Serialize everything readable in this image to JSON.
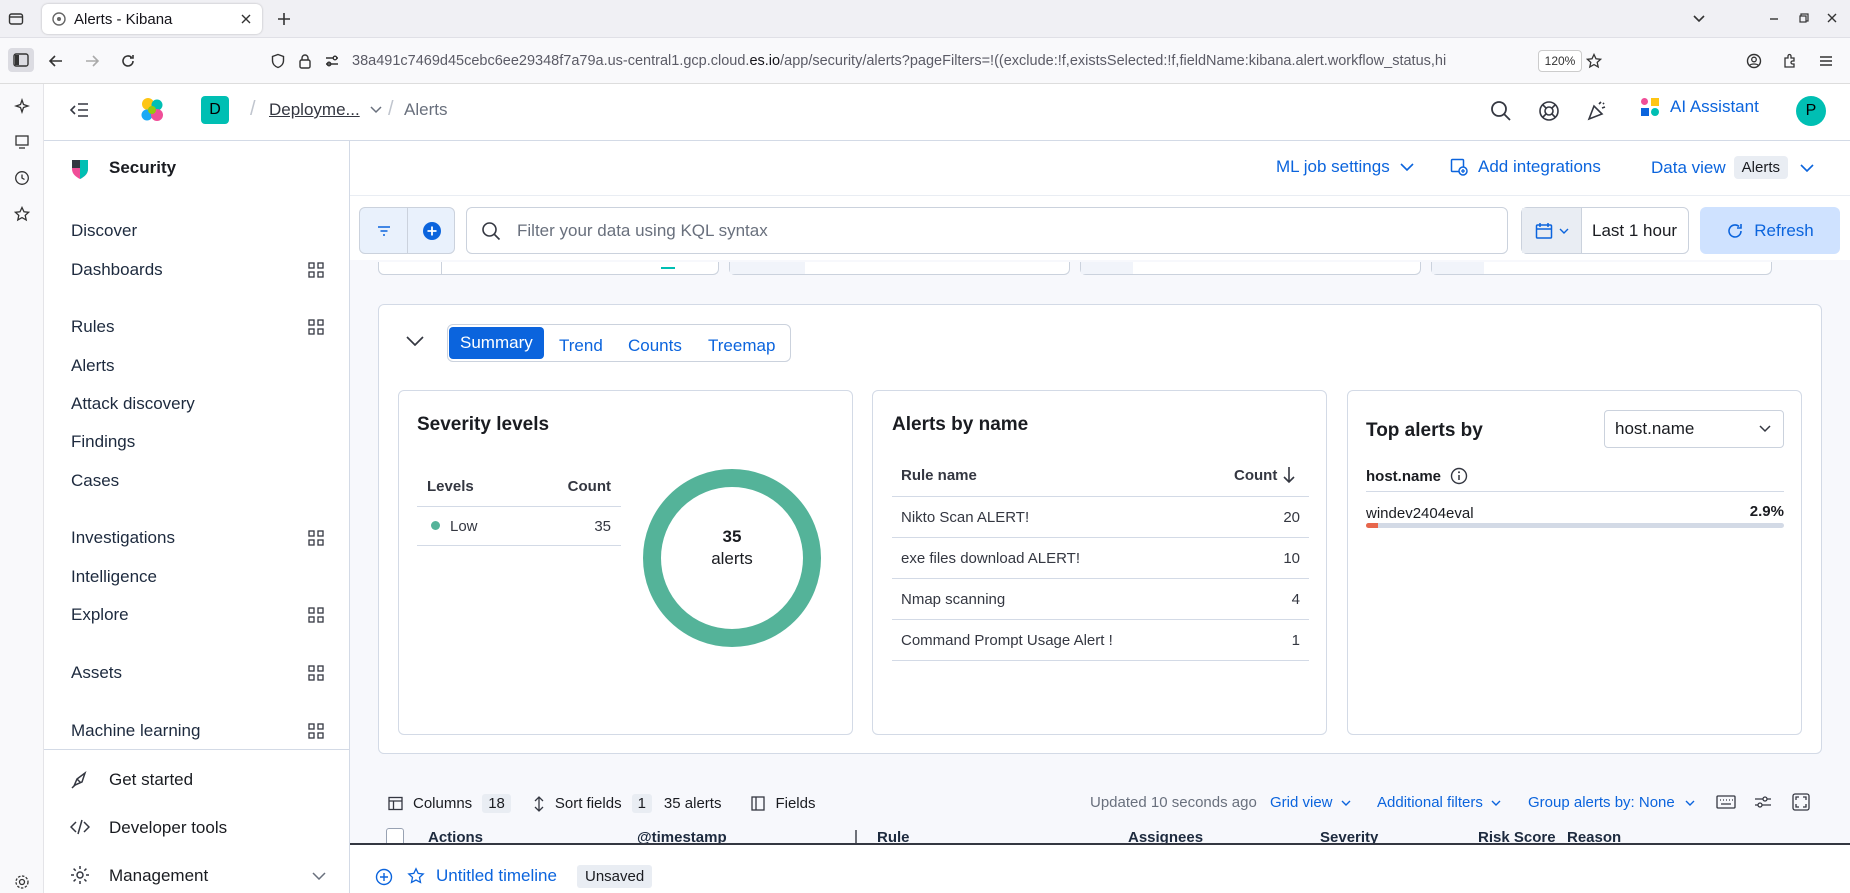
{
  "browser": {
    "tab_title": "Alerts - Kibana",
    "url_host_prefix": "38a491c7469d45cebc6ee29348f7a79a.us-central1.gcp.cloud.",
    "url_host_main": "es.io",
    "url_path": "/app/security/alerts?pageFilters=!((exclude:!f,existsSelected:!f,fieldName:kibana.alert.workflow_status,hi",
    "zoom": "120%"
  },
  "header": {
    "space_initial": "D",
    "breadcrumb_deployment": "Deployme...",
    "breadcrumb_alerts": "Alerts",
    "ai_assistant": "AI Assistant",
    "user_initial": "P"
  },
  "sidebar": {
    "title": "Security",
    "items": [
      {
        "label": "Discover"
      },
      {
        "label": "Dashboards"
      },
      {
        "label": "Rules"
      },
      {
        "label": "Alerts"
      },
      {
        "label": "Attack discovery"
      },
      {
        "label": "Findings"
      },
      {
        "label": "Cases"
      },
      {
        "label": "Investigations"
      },
      {
        "label": "Intelligence"
      },
      {
        "label": "Explore"
      },
      {
        "label": "Assets"
      },
      {
        "label": "Machine learning"
      }
    ],
    "get_started": "Get started",
    "developer_tools": "Developer tools",
    "management": "Management"
  },
  "toolbar": {
    "ml_job_settings": "ML job settings",
    "add_integrations": "Add integrations",
    "data_view_label": "Data view",
    "data_view_value": "Alerts"
  },
  "query": {
    "placeholder": "Filter your data using KQL syntax",
    "time_range": "Last 1 hour",
    "refresh": "Refresh"
  },
  "tabs": [
    "Summary",
    "Trend",
    "Counts",
    "Treemap"
  ],
  "severity": {
    "title": "Severity levels",
    "col_levels": "Levels",
    "col_count": "Count",
    "rows": [
      {
        "level": "Low",
        "count": "35",
        "color": "#54b399"
      }
    ],
    "donut_value": "35",
    "donut_label": "alerts"
  },
  "alerts_by_name": {
    "title": "Alerts by name",
    "col_rule": "Rule name",
    "col_count": "Count",
    "rows": [
      {
        "name": "Nikto Scan ALERT!",
        "count": "20"
      },
      {
        "name": "exe files download ALERT!",
        "count": "10"
      },
      {
        "name": "Nmap scanning",
        "count": "4"
      },
      {
        "name": "Command Prompt Usage Alert !",
        "count": "1"
      }
    ]
  },
  "top_alerts": {
    "title": "Top alerts by",
    "select_value": "host.name",
    "field_label": "host.name",
    "rows": [
      {
        "host": "windev2404eval",
        "pct": "2.9%",
        "fraction": 0.029
      }
    ]
  },
  "table_toolbar": {
    "columns": "Columns",
    "columns_count": "18",
    "sort_fields": "Sort fields",
    "sort_count": "1",
    "alerts_count": "35 alerts",
    "fields": "Fields",
    "updated": "Updated 10 seconds ago",
    "grid_view": "Grid view",
    "additional_filters": "Additional filters",
    "group_by": "Group alerts by: None"
  },
  "table_headers": [
    "Actions",
    "@timestamp",
    "Rule",
    "Assignees",
    "Severity",
    "Risk Score",
    "Reason"
  ],
  "timeline": {
    "title": "Untitled timeline",
    "status": "Unsaved"
  }
}
